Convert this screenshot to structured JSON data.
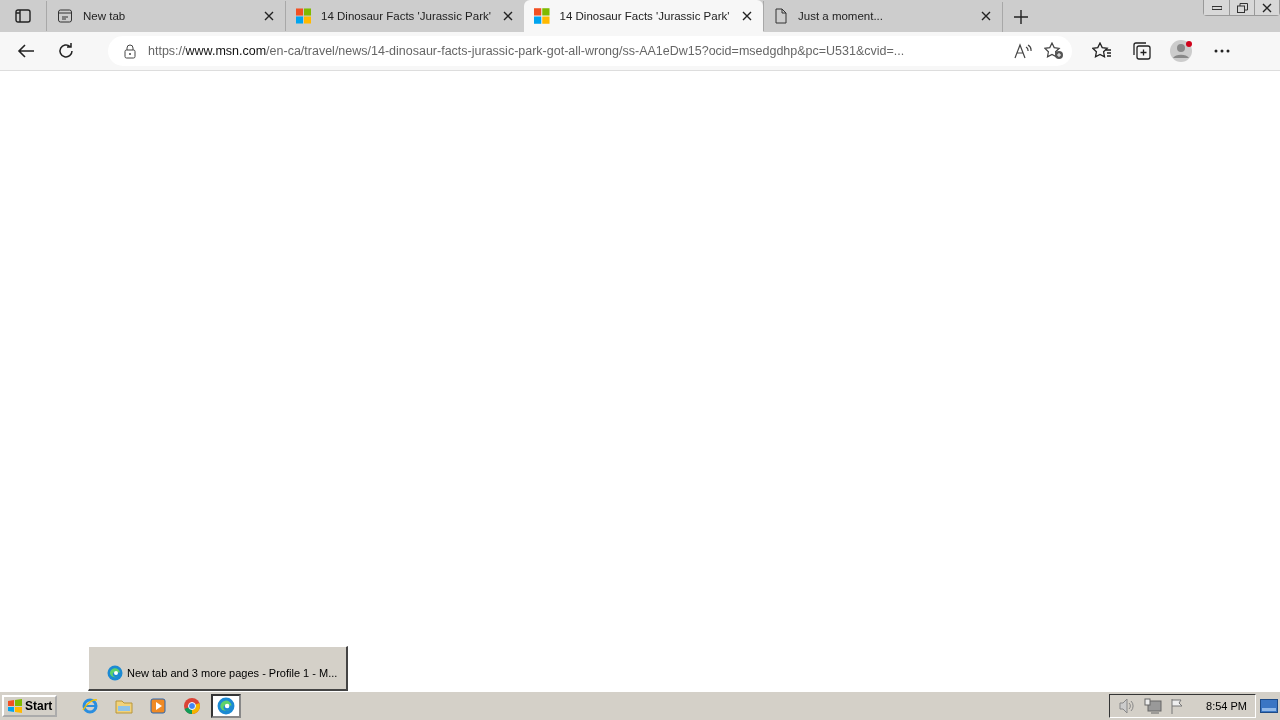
{
  "tabs": [
    {
      "kind": "newtab",
      "title": "New tab",
      "selected": false
    },
    {
      "kind": "msn",
      "title": "14 Dinosaur Facts 'Jurassic Park'",
      "selected": false
    },
    {
      "kind": "msn",
      "title": "14 Dinosaur Facts 'Jurassic Park'",
      "selected": true
    },
    {
      "kind": "page",
      "title": "Just a moment...",
      "selected": false
    }
  ],
  "address": {
    "scheme": "https://",
    "host": "www.msn.com",
    "path": "/en-ca/travel/news/14-dinosaur-facts-jurassic-park-got-all-wrong/ss-AA1eDw15?ocid=msedgdhp&pc=U531&cvid=..."
  },
  "taskbar": {
    "start": "Start",
    "apps": [
      {
        "kind": "ie",
        "selected": false
      },
      {
        "kind": "folder",
        "selected": false
      },
      {
        "kind": "media",
        "selected": false
      },
      {
        "kind": "chrome",
        "selected": false
      },
      {
        "kind": "edge",
        "selected": true
      }
    ],
    "clock": "8:54 PM"
  },
  "preview": {
    "title": "New tab and 3 more pages - Profile 1 - M..."
  }
}
